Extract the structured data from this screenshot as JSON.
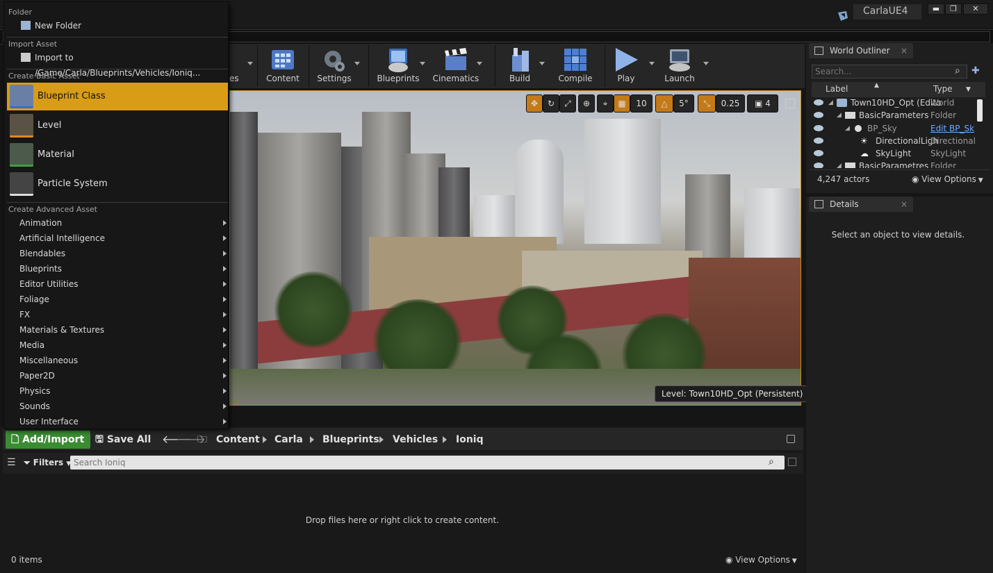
{
  "window": {
    "project_name": "CarlaUE4",
    "minimize": "▬",
    "maximize": "❐",
    "close": "✕"
  },
  "toolbar": {
    "partial_label": "es",
    "buttons": [
      {
        "label": "Content",
        "icon": "content-icon"
      },
      {
        "label": "Settings",
        "icon": "settings-icon"
      },
      {
        "label": "Blueprints",
        "icon": "blueprints-icon"
      },
      {
        "label": "Cinematics",
        "icon": "cinematics-icon"
      },
      {
        "label": "Build",
        "icon": "build-icon"
      },
      {
        "label": "Compile",
        "icon": "compile-icon"
      },
      {
        "label": "Play",
        "icon": "play-icon"
      },
      {
        "label": "Launch",
        "icon": "launch-icon"
      }
    ]
  },
  "viewport": {
    "grid_snap": "10",
    "rotation_snap": "5°",
    "scale_snap": "0.25",
    "camera_speed": "4",
    "level_label": "Level:  Town10HD_Opt (Persistent)"
  },
  "context_menu": {
    "folder_header": "Folder",
    "new_folder": "New Folder",
    "import_header": "Import Asset",
    "import_to": "Import to /Game/Carla/Blueprints/Vehicles/Ioniq...",
    "basic_header": "Create Basic Asset",
    "basic_assets": [
      {
        "label": "Blueprint Class",
        "selected": true
      },
      {
        "label": "Level"
      },
      {
        "label": "Material"
      },
      {
        "label": "Particle System"
      }
    ],
    "advanced_header": "Create Advanced Asset",
    "advanced_items": [
      "Animation",
      "Artificial Intelligence",
      "Blendables",
      "Blueprints",
      "Editor Utilities",
      "Foliage",
      "FX",
      "Materials & Textures",
      "Media",
      "Miscellaneous",
      "Paper2D",
      "Physics",
      "Sounds",
      "User Interface"
    ]
  },
  "content_browser": {
    "add_import": "Add/Import",
    "save_all": "Save All",
    "breadcrumbs": [
      "Content",
      "Carla",
      "Blueprints",
      "Vehicles",
      "Ioniq"
    ],
    "filters": "Filters",
    "search_placeholder": "Search Ioniq",
    "drop_hint": "Drop files here or right click to create content.",
    "item_count": "0 items",
    "view_options": "View Options"
  },
  "world_outliner": {
    "tab": "World Outliner",
    "search_placeholder": "Search...",
    "col_label": "Label",
    "col_type": "Type",
    "rows": [
      {
        "label": "Town10HD_Opt (Edito",
        "type": "World"
      },
      {
        "label": "BasicParameters",
        "type": "Folder"
      },
      {
        "label": "BP_Sky",
        "type": "Edit BP_Sk"
      },
      {
        "label": "DirectionalLigh",
        "type": "DirectionalL"
      },
      {
        "label": "SkyLight",
        "type": "SkyLight"
      },
      {
        "label": "BasicParametres",
        "type": "Folder"
      }
    ],
    "actor_count": "4,247 actors",
    "view_options": "View Options"
  },
  "details": {
    "tab": "Details",
    "empty_message": "Select an object to view details."
  },
  "colors": {
    "accent_orange": "#d89c16",
    "add_import_green": "#3a8c32",
    "panel_bg": "#1e1e1e"
  }
}
